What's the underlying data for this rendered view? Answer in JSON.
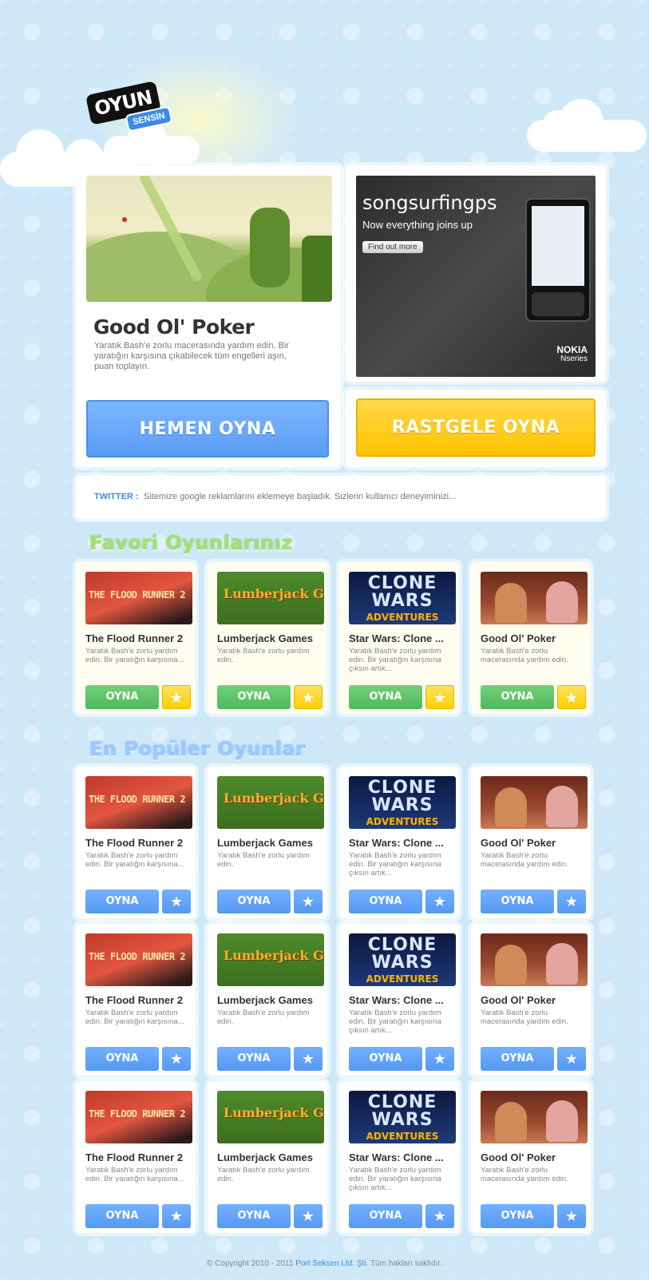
{
  "logo": {
    "line1": "OYUN",
    "line2": "SENSİN"
  },
  "featured": {
    "title": "Good Ol' Poker",
    "description": "Yaratık Bash'e zorlu macerasında yardım edin. Bir yaratığın karşısına çıkabilecek tüm engelleri aşın, puan toplayın.",
    "play_label": "HEMEN OYNA"
  },
  "ad": {
    "brand": "songsurfingps",
    "tagline": "Now everything joins up",
    "cta": "Find out more",
    "maker": "NOKIA",
    "series": "Nseries"
  },
  "random_label": "RASTGELE OYNA",
  "twitter": {
    "label": "TWITTER :",
    "text": "Sitemize google reklamlarını eklemeye başladık. Sizlerin kullanıcı deneyiminizi..."
  },
  "favorites_title": "Favori Oyunlarınız",
  "popular_title": "En Popüler Oyunlar",
  "games": [
    {
      "title": "The Flood Runner 2",
      "thumb_text": "THE FLOOD RUNNER 2",
      "desc": "Yaratık Bash'e zorlu yardım edin. Bir yaratığın karşısına..."
    },
    {
      "title": "Lumberjack Games",
      "thumb_text": "Lumberjack Games",
      "desc": "Yaratık Bash'e zorlu yardım edin."
    },
    {
      "title": "Star Wars: Clone ...",
      "thumb_text1": "CLONE WARS",
      "thumb_text2": "ADVENTURES",
      "desc": "Yaratık Bash'e zorlu yardım edin. Bir yaratığın karşısına çıksın artık..."
    },
    {
      "title": "Good Ol' Poker",
      "desc": "Yaratık Bash'e zorlu macerasında yardım edin."
    }
  ],
  "oyna_label": "OYNA",
  "star_icon": "★",
  "footer": {
    "prefix": "© Copyright 2010 - 2011",
    "company": "Port Seksen Ltd. Şti.",
    "suffix": "Tüm hakları saklıdır."
  }
}
